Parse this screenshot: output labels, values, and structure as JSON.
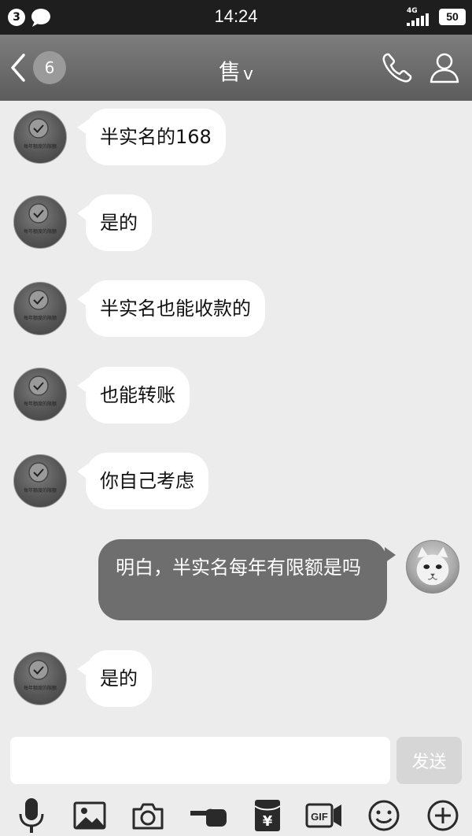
{
  "status_bar": {
    "notification_count": "3",
    "time": "14:24",
    "network": "4G",
    "battery": "50"
  },
  "header": {
    "unread_count": "6",
    "title": "售",
    "title_suffix": "v"
  },
  "messages": [
    {
      "side": "left",
      "text": "半实名的168"
    },
    {
      "side": "left",
      "text": "是的"
    },
    {
      "side": "left",
      "text": "半实名也能收款的"
    },
    {
      "side": "left",
      "text": "也能转账"
    },
    {
      "side": "left",
      "text": "你自己考虑"
    },
    {
      "side": "right",
      "text": "明白，半实名每年有限额是吗"
    },
    {
      "side": "left",
      "text": "是的"
    }
  ],
  "contact_avatar_caption": "每年额度的限额",
  "composer": {
    "placeholder": "",
    "send_label": "发送"
  },
  "toolbar": {
    "gif_label": "GIF",
    "redpacket_label": "¥",
    "icons": [
      "microphone-icon",
      "image-icon",
      "camera-icon",
      "poke-hand-icon",
      "red-packet-icon",
      "gif-icon",
      "emoji-icon",
      "plus-icon"
    ]
  },
  "colors": {
    "status_bar": "#1e1e1e",
    "header": "#6d6d6d",
    "background": "#ececec",
    "incoming_bubble": "#ffffff",
    "outgoing_bubble": "#6e6e6e",
    "send_button": "#d6d6d6"
  }
}
